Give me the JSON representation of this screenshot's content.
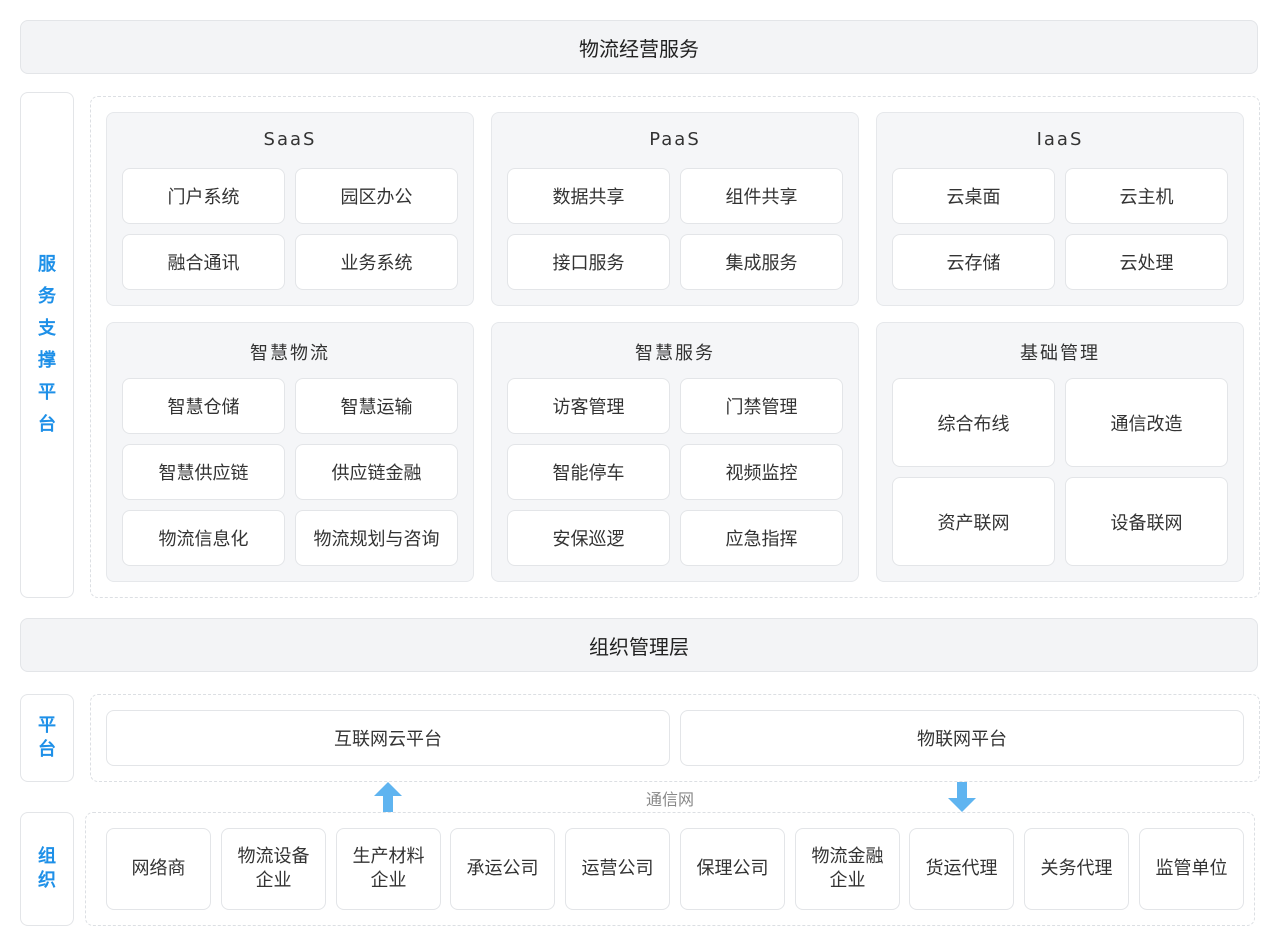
{
  "top_bar": "物流经营服务",
  "support_label": [
    "服",
    "务",
    "支",
    "撑",
    "平",
    "台"
  ],
  "panels": [
    {
      "title": "SaaS",
      "items": [
        "门户系统",
        "园区办公",
        "融合通讯",
        "业务系统"
      ]
    },
    {
      "title": "PaaS",
      "items": [
        "数据共享",
        "组件共享",
        "接口服务",
        "集成服务"
      ]
    },
    {
      "title": "IaaS",
      "items": [
        "云桌面",
        "云主机",
        "云存储",
        "云处理"
      ]
    },
    {
      "title": "智慧物流",
      "items": [
        "智慧仓储",
        "智慧运输",
        "智慧供应链",
        "供应链金融",
        "物流信息化",
        "物流规划与咨询"
      ]
    },
    {
      "title": "智慧服务",
      "items": [
        "访客管理",
        "门禁管理",
        "智能停车",
        "视频监控",
        "安保巡逻",
        "应急指挥"
      ]
    },
    {
      "title": "基础管理",
      "items": [
        "综合布线",
        "通信改造",
        "资产联网",
        "设备联网"
      ]
    }
  ],
  "middle_bar": "组织管理层",
  "platform_label": [
    "平",
    "台"
  ],
  "platforms": [
    "互联网云平台",
    "物联网平台"
  ],
  "network_label": "通信网",
  "org_label": [
    "组",
    "织"
  ],
  "orgs": [
    "网络商",
    "物流设备企业",
    "生产材料企业",
    "承运公司",
    "运营公司",
    "保理公司",
    "物流金融企业",
    "货运代理",
    "关务代理",
    "监管单位"
  ],
  "colors": {
    "accent": "#1e90e8",
    "arrow": "#5fb4f0"
  }
}
